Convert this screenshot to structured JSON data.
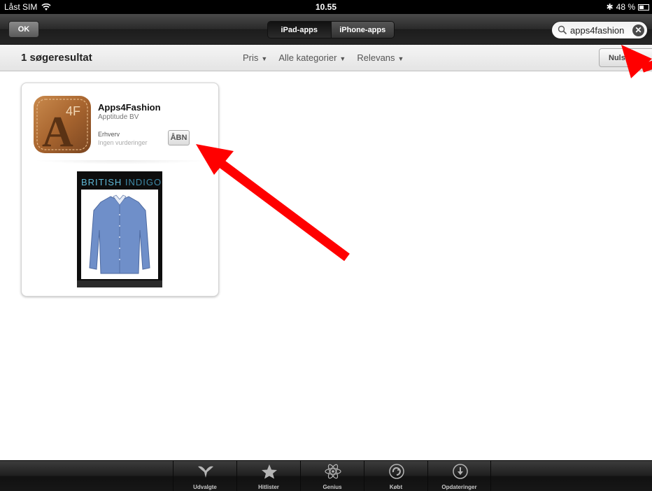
{
  "status_bar": {
    "carrier": "Låst SIM",
    "time": "10.55",
    "battery": "48 %",
    "battery_level": 0.48
  },
  "nav_bar": {
    "ok_label": "OK",
    "segments": [
      {
        "label": "iPad-apps",
        "selected": true
      },
      {
        "label": "iPhone-apps",
        "selected": false
      }
    ],
    "search_value": "apps4fashion"
  },
  "sub_bar": {
    "result_count": "1 søgeresultat",
    "filters": [
      "Pris",
      "Alle kategorier",
      "Relevans"
    ],
    "reset_label": "Nulstil"
  },
  "result": {
    "icon_letters": {
      "big": "A",
      "small": "4F"
    },
    "name": "Apps4Fashion",
    "developer": "Apptitude BV",
    "category": "Erhverv",
    "rating": "Ingen vurderinger",
    "action_label": "ÅBN",
    "screenshot_brand": {
      "part1": "BRITISH",
      "part2": "INDIGO"
    }
  },
  "tab_bar": {
    "tabs": [
      {
        "label": "Udvalgte",
        "icon": "featured-icon"
      },
      {
        "label": "Hitlister",
        "icon": "star-icon"
      },
      {
        "label": "Genius",
        "icon": "atom-icon"
      },
      {
        "label": "Købt",
        "icon": "purchased-icon"
      },
      {
        "label": "Opdateringer",
        "icon": "download-icon"
      }
    ]
  },
  "colors": {
    "annotation_arrow": "#ff0000",
    "brand_blue": "#5fb8d6"
  }
}
